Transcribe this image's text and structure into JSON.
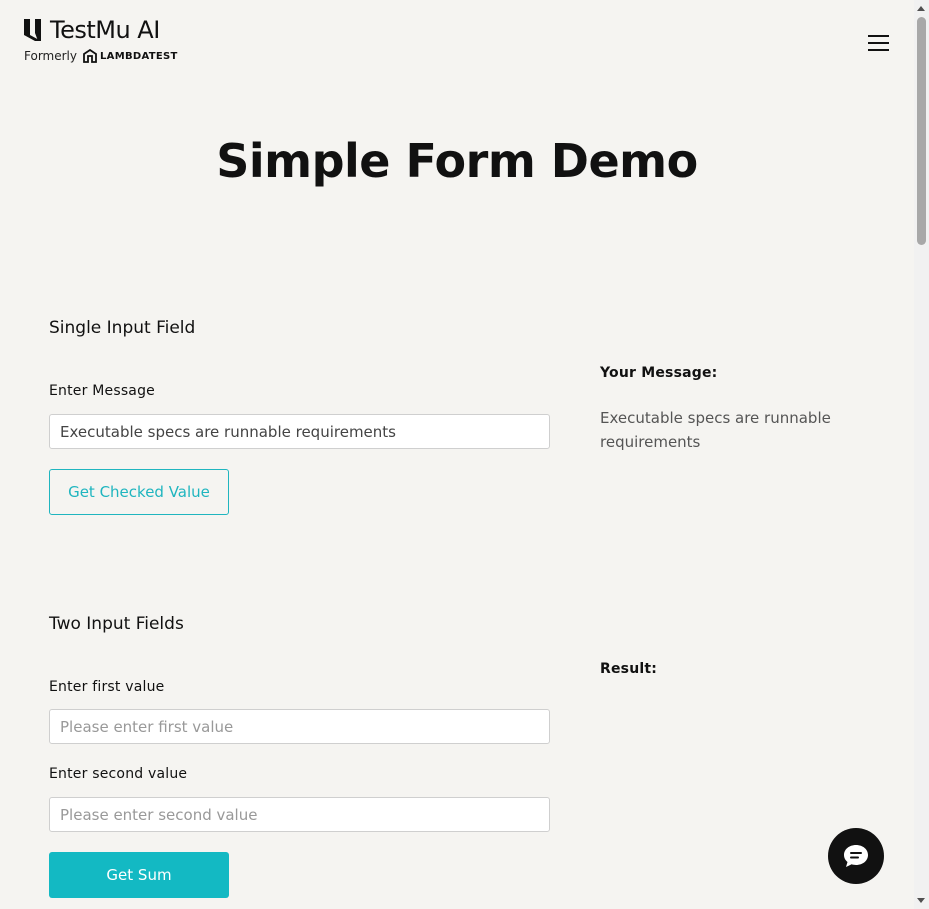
{
  "header": {
    "brand_name": "TestMu AI",
    "formerly_text": "Formerly",
    "previous_brand": "LAMBDATEST",
    "menu_icon": "hamburger-menu-icon"
  },
  "page_title": "Simple Form Demo",
  "single_input": {
    "section_title": "Single Input Field",
    "label": "Enter Message",
    "value": "Executable specs are runnable requirements",
    "button_label": "Get Checked Value",
    "result_label": "Your Message:",
    "result_value": "Executable specs are runnable requirements"
  },
  "two_inputs": {
    "section_title": "Two Input Fields",
    "first_label": "Enter first value",
    "first_placeholder": "Please enter first value",
    "first_value": "",
    "second_label": "Enter second value",
    "second_placeholder": "Please enter second value",
    "second_value": "",
    "button_label": "Get Sum",
    "result_label": "Result:"
  },
  "chat": {
    "icon": "chat-bubble-icon"
  },
  "colors": {
    "background": "#f5f4f1",
    "accent": "#13b9c3",
    "text": "#111111"
  }
}
